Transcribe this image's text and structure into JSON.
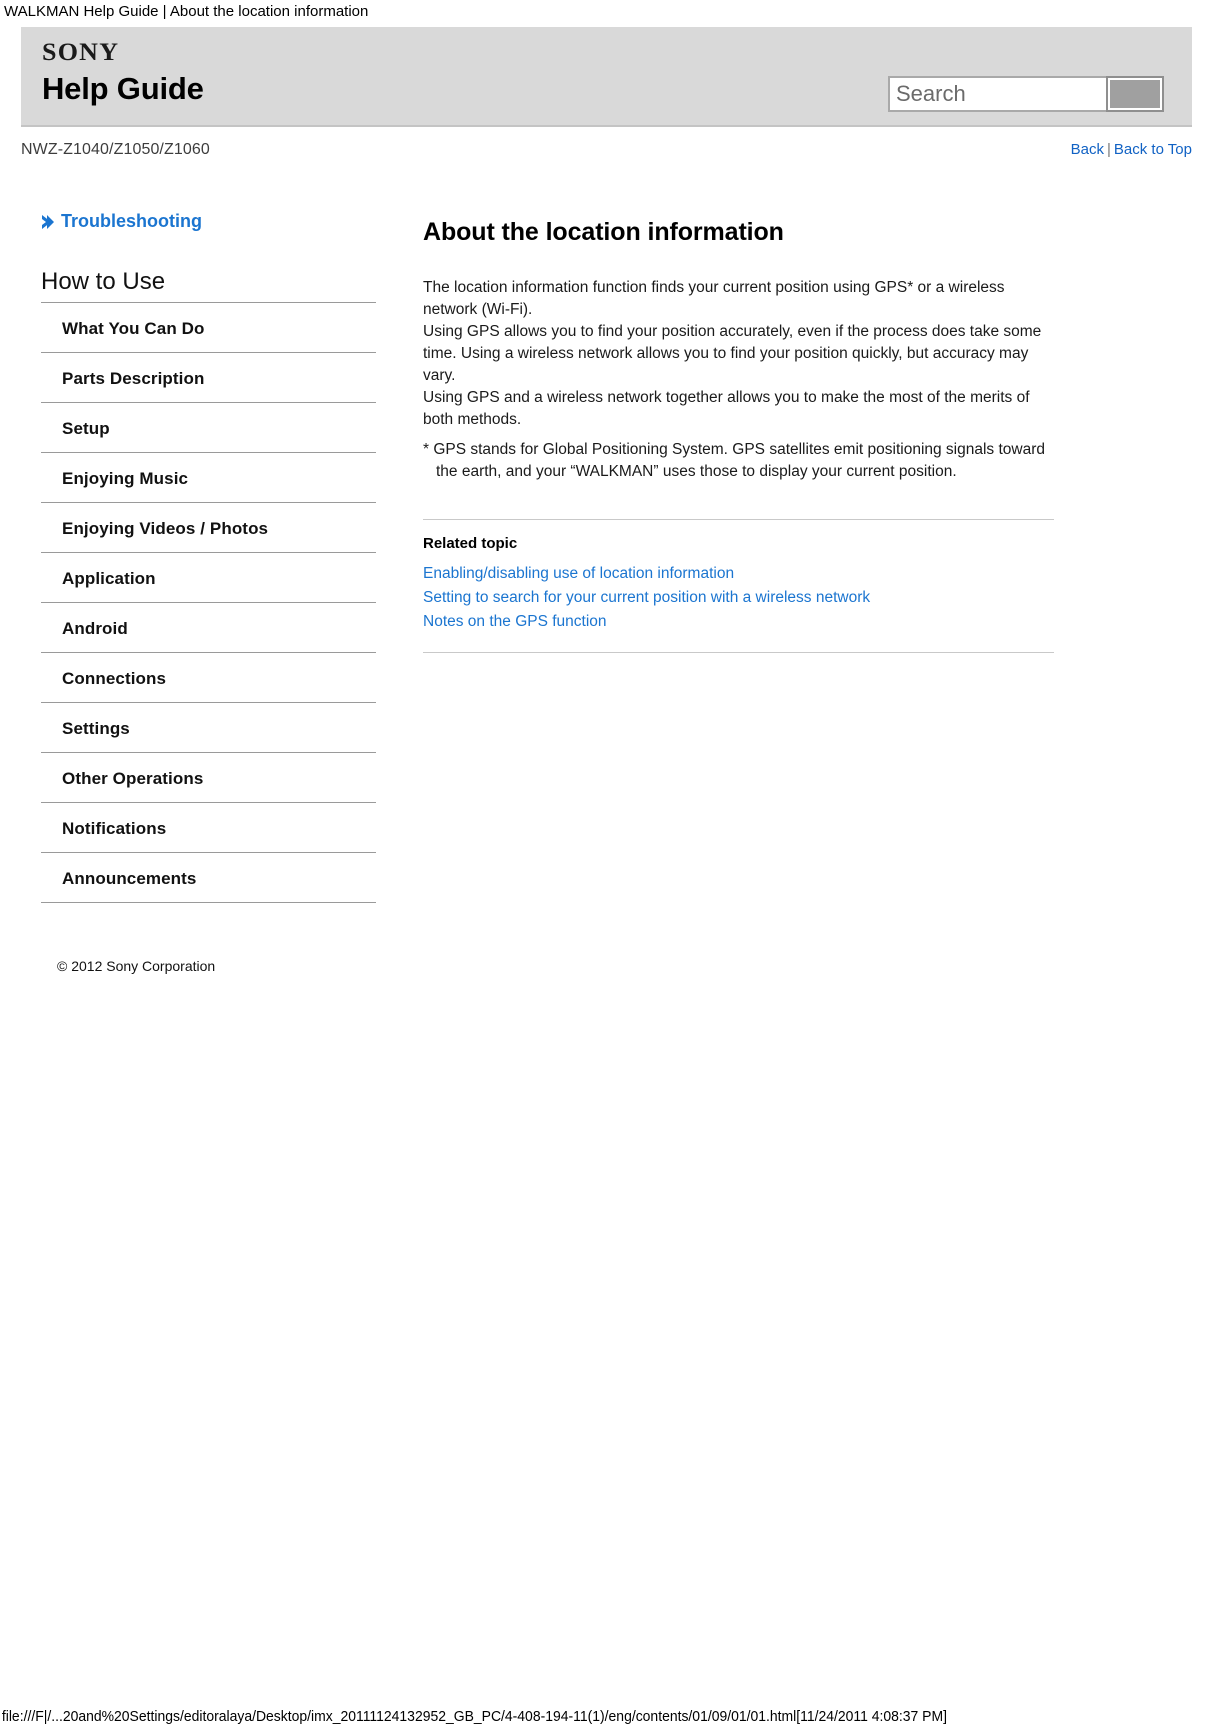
{
  "browser": {
    "print_title": "WALKMAN Help Guide | About the location information",
    "status_url": "file:///F|/...20and%20Settings/editoralaya/Desktop/imx_20111124132952_GB_PC/4-408-194-11(1)/eng/contents/01/09/01/01.html[11/24/2011 4:08:37 PM]"
  },
  "header": {
    "brand": "SONY",
    "title": "Help Guide",
    "model": "NWZ-Z1040/Z1050/Z1060",
    "search": {
      "placeholder": "Search",
      "value": "",
      "button_label": ""
    },
    "nav": {
      "back": "Back",
      "separator": "|",
      "back_to_top": "Back to Top"
    }
  },
  "sidebar": {
    "troubleshooting": "Troubleshooting",
    "section_heading": "How to Use",
    "items": [
      {
        "label": "What You Can Do"
      },
      {
        "label": "Parts Description"
      },
      {
        "label": "Setup"
      },
      {
        "label": "Enjoying Music"
      },
      {
        "label": "Enjoying Videos / Photos"
      },
      {
        "label": "Application"
      },
      {
        "label": "Android"
      },
      {
        "label": "Connections"
      },
      {
        "label": "Settings"
      },
      {
        "label": "Other Operations"
      },
      {
        "label": "Notifications"
      },
      {
        "label": "Announcements"
      }
    ],
    "copyright": "© 2012 Sony Corporation"
  },
  "article": {
    "title": "About the location information",
    "paragraphs": [
      "The location information function finds your current position using GPS* or a wireless network (Wi-Fi).",
      "Using GPS allows you to find your position accurately, even if the process does take some time. Using a wireless network allows you to find your position quickly, but accuracy may vary.",
      "Using GPS and a wireless network together allows you to make the most of the merits of both methods."
    ],
    "footnote": "* GPS stands for Global Positioning System. GPS satellites emit positioning signals toward the earth, and your “WALKMAN” uses those to display your current position.",
    "related": {
      "heading": "Related topic",
      "links": [
        {
          "label": "Enabling/disabling use of location information"
        },
        {
          "label": "Setting to search for your current position with a wireless network"
        },
        {
          "label": "Notes on the GPS function"
        }
      ]
    }
  },
  "colors": {
    "link": "#1b75d0",
    "banner_bg": "#d9d9d9",
    "nav_link": "#1162c4"
  }
}
